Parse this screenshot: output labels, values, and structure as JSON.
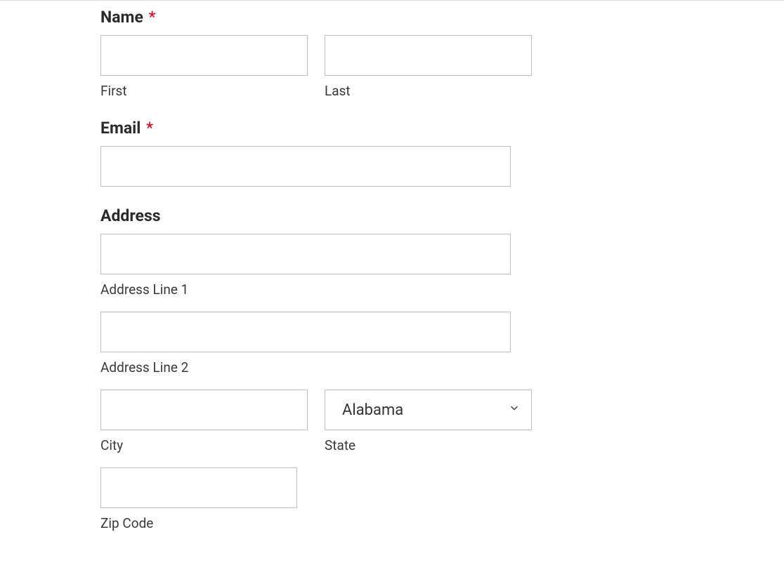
{
  "form": {
    "name": {
      "label": "Name",
      "required_mark": "*",
      "first_sublabel": "First",
      "last_sublabel": "Last",
      "first_value": "",
      "last_value": ""
    },
    "email": {
      "label": "Email",
      "required_mark": "*",
      "value": ""
    },
    "address": {
      "label": "Address",
      "line1_sublabel": "Address Line 1",
      "line2_sublabel": "Address Line 2",
      "city_sublabel": "City",
      "state_sublabel": "State",
      "zip_sublabel": "Zip Code",
      "line1_value": "",
      "line2_value": "",
      "city_value": "",
      "state_value": "Alabama",
      "zip_value": ""
    }
  }
}
